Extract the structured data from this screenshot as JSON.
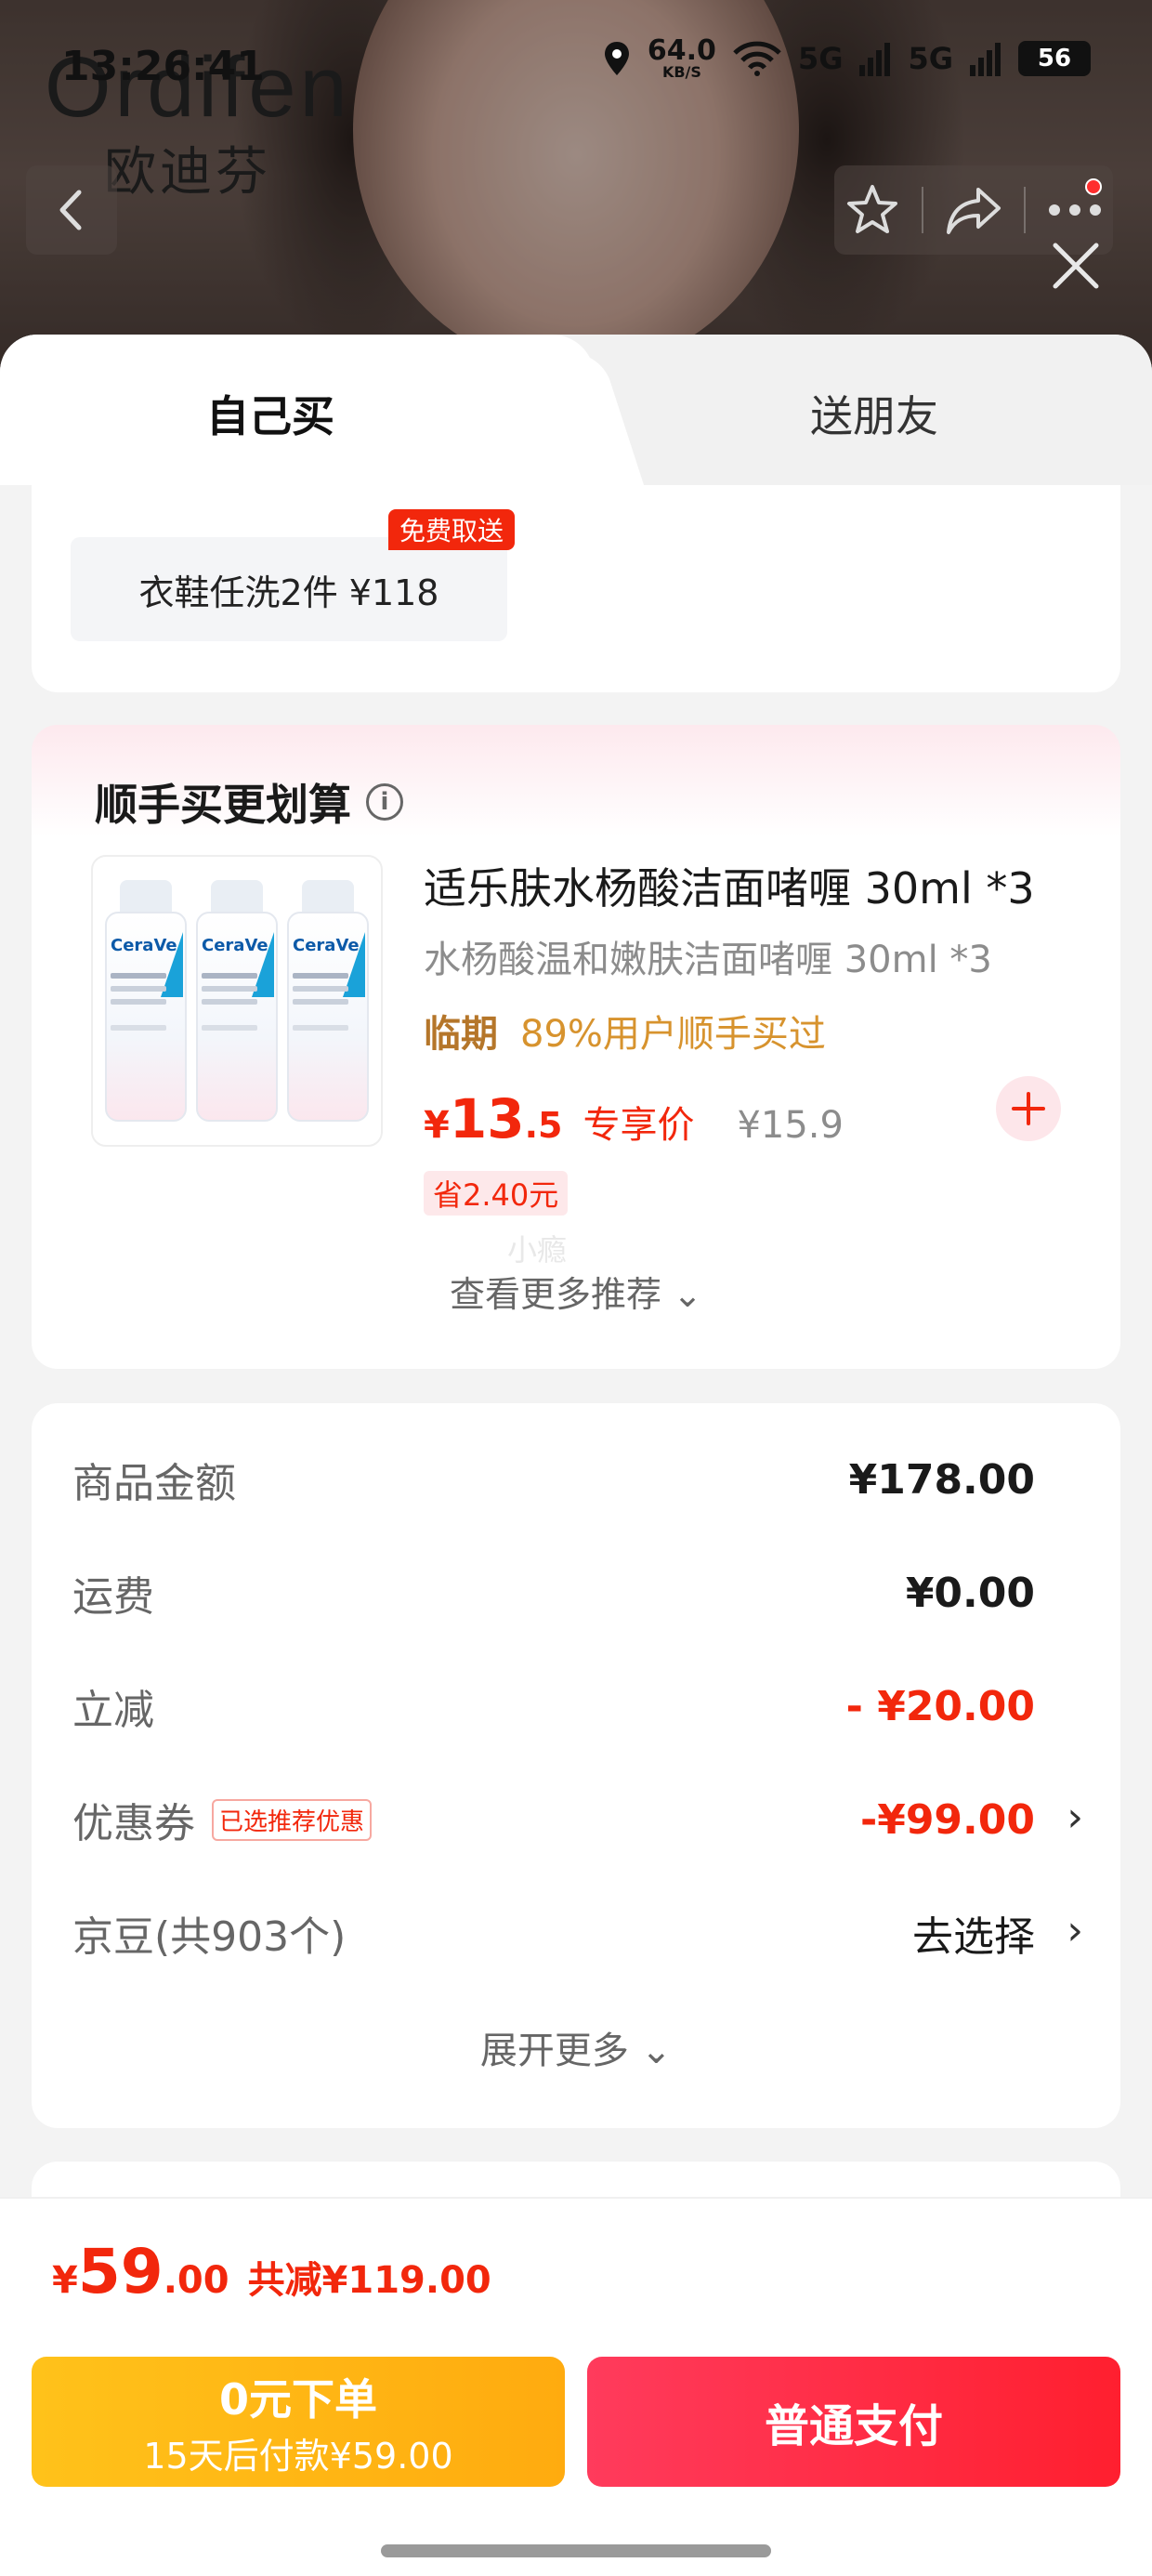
{
  "status_bar": {
    "time": "13:26:41",
    "speed_value": "64.0",
    "speed_unit": "KB/S",
    "signal_1": "5G",
    "signal_2": "5G",
    "battery": "56"
  },
  "brand": {
    "english": "Ordifen",
    "chinese": "欧迪芬"
  },
  "tabs": {
    "self": "自己买",
    "gift": "送朋友"
  },
  "wash": {
    "label": "衣鞋任洗2件 ¥118",
    "badge": "免费取送"
  },
  "addon": {
    "title": "顺手买更划算",
    "product": {
      "name": "适乐肤水杨酸洁面啫喱 30ml *3",
      "subtitle": "水杨酸温和嫩肤洁面啫喱 30ml *3",
      "tag_expiry": "临期",
      "tag_popularity": "89%用户顺手买过",
      "price_currency": "¥",
      "price_int": "13",
      "price_dec": ".5",
      "price_label": "专享价",
      "original_price": "¥15.9",
      "save": "省2.40元",
      "image_brand": "CeraVe"
    },
    "ghost_text": "小瘾",
    "more": "查看更多推荐 ⌄"
  },
  "summary": {
    "rows": [
      {
        "label": "商品金额",
        "value": "¥178.00"
      },
      {
        "label": "运费",
        "value": "¥0.00"
      },
      {
        "label": "立减",
        "value": "- ¥20.00"
      },
      {
        "label": "优惠券",
        "tag": "已选推荐优惠",
        "value": "-¥99.00"
      },
      {
        "label": "京豆(共903个)",
        "value": "去选择"
      }
    ],
    "expand": "展开更多 ⌄"
  },
  "bottom": {
    "total_currency": "¥",
    "total_int": "59",
    "total_dec": ".00",
    "total_reduce": "共减¥119.00",
    "zero_btn_line1": "0元下单",
    "zero_btn_line2": "15天后付款¥59.00",
    "pay_btn": "普通支付"
  },
  "colors": {
    "accent_red": "#f2270c",
    "gold": "#ffb514",
    "pay_red": "#ff2340"
  }
}
